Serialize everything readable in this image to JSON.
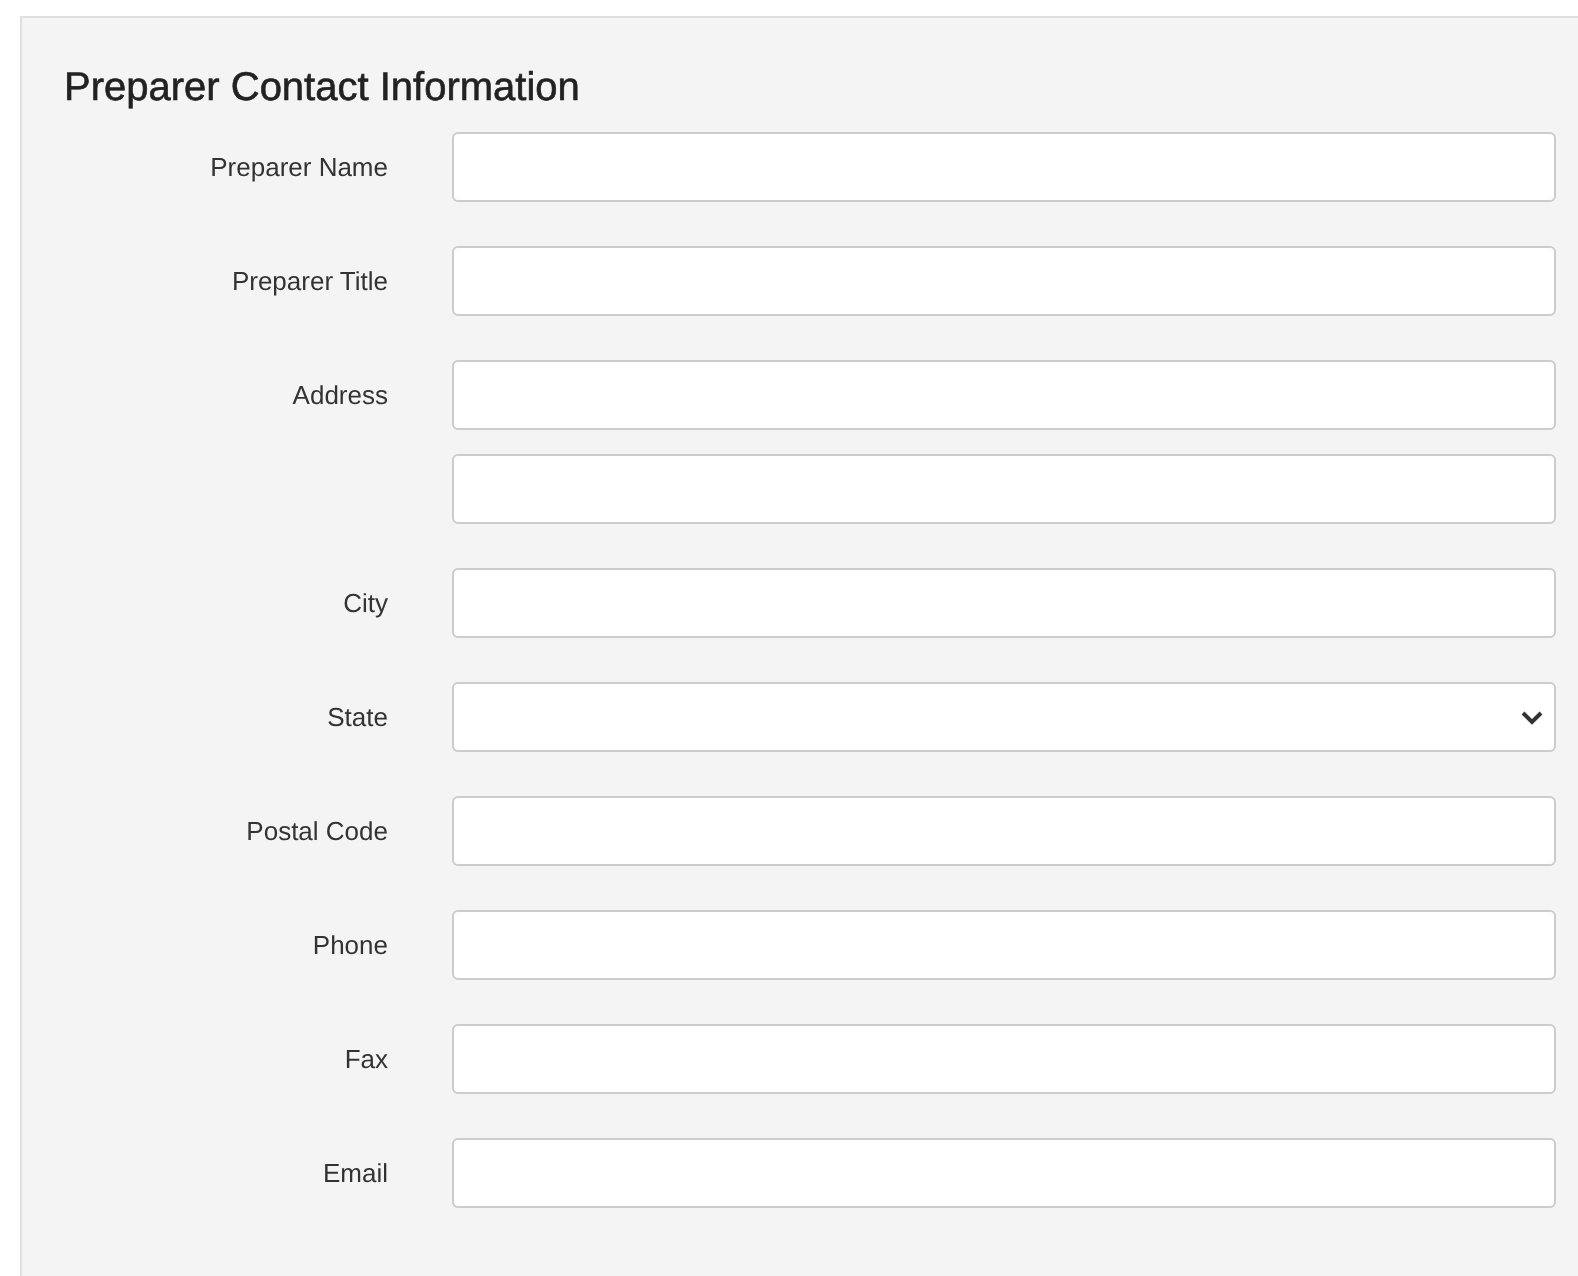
{
  "section": {
    "title": "Preparer Contact Information"
  },
  "fields": [
    {
      "label": "Preparer Name",
      "kind": "text"
    },
    {
      "label": "Preparer Title",
      "kind": "text"
    },
    {
      "label": "Address",
      "kind": "text"
    },
    {
      "kind": "text"
    },
    {
      "label": "City",
      "kind": "text"
    },
    {
      "label": "State",
      "kind": "select"
    },
    {
      "label": "Postal Code",
      "kind": "text"
    },
    {
      "label": "Phone",
      "kind": "text"
    },
    {
      "label": "Fax",
      "kind": "text"
    },
    {
      "label": "Email",
      "kind": "text"
    }
  ]
}
